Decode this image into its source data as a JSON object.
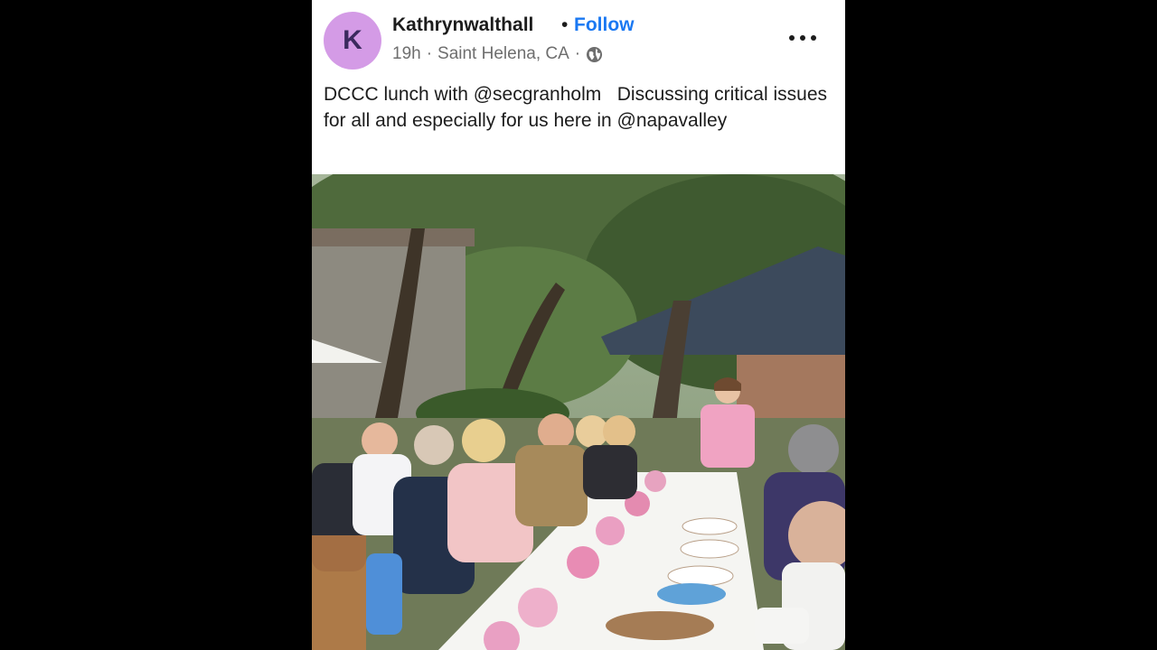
{
  "post": {
    "author": {
      "avatar_letter": "K",
      "username": "Kathrynwalthall",
      "separator": "•",
      "follow_label": "Follow"
    },
    "meta": {
      "time": "19h",
      "dot1": "·",
      "location": "Saint Helena, CA",
      "dot2": "·",
      "visibility_icon": "globe-icon"
    },
    "more_icon": "more-options-icon",
    "caption": "DCCC lunch with @secgranholm   Discussing critical issues for all and especially for us here in @napavalley",
    "colors": {
      "avatar": "#d49be6",
      "follow": "#1a78f2",
      "meta_text": "#6e6e6e",
      "background": "#000000"
    }
  }
}
